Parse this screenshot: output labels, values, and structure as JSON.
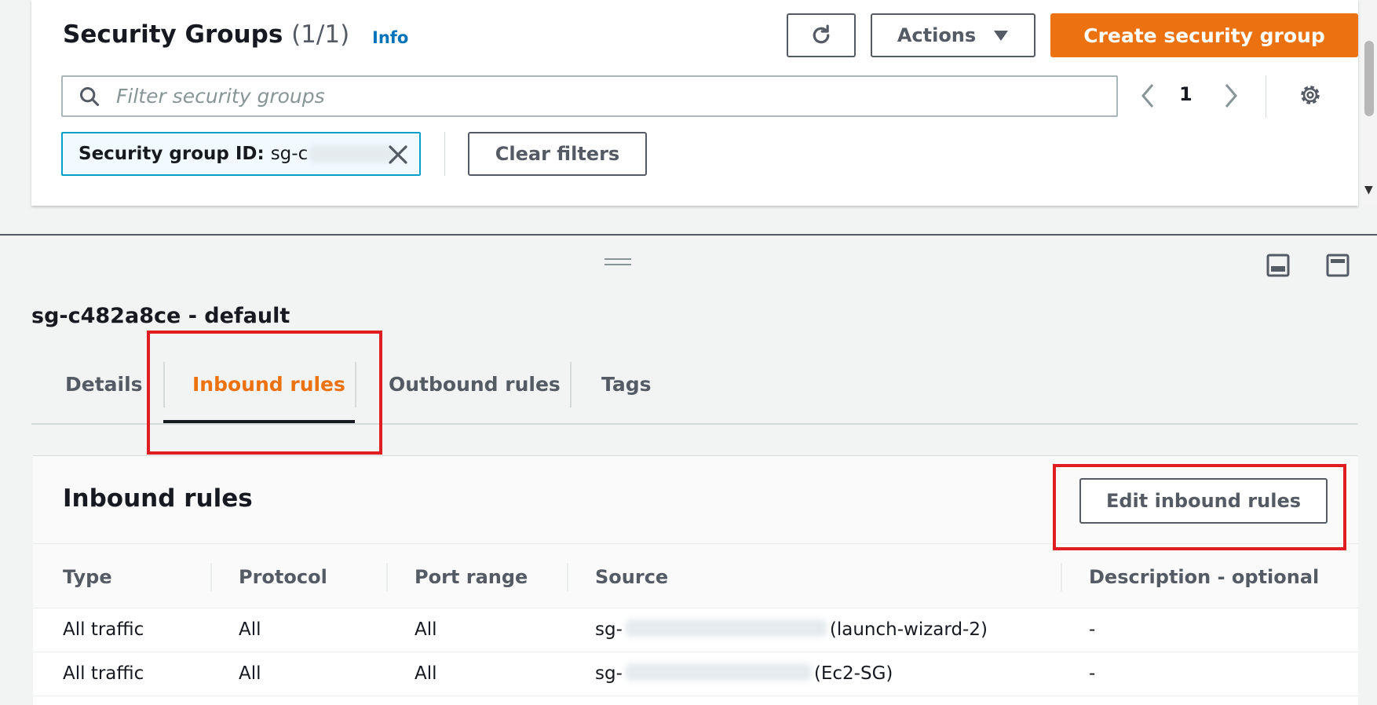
{
  "header": {
    "title": "Security Groups",
    "count": "(1/1)",
    "info_link": "Info"
  },
  "toolbar": {
    "actions_label": "Actions",
    "create_label": "Create security group"
  },
  "search": {
    "placeholder": "Filter security groups",
    "value": ""
  },
  "pagination": {
    "page": "1"
  },
  "filter_token": {
    "label": "Security group ID:",
    "value": "sg-c"
  },
  "clear_filters_label": "Clear filters",
  "details": {
    "title": "sg-c482a8ce - default"
  },
  "tabs": [
    {
      "label": "Details"
    },
    {
      "label": "Inbound rules",
      "active": true
    },
    {
      "label": "Outbound rules"
    },
    {
      "label": "Tags"
    }
  ],
  "inbound": {
    "title": "Inbound rules",
    "edit_label": "Edit inbound rules",
    "columns": [
      "Type",
      "Protocol",
      "Port range",
      "Source",
      "Description - optional"
    ],
    "rows": [
      {
        "type": "All traffic",
        "protocol": "All",
        "port": "All",
        "source_prefix": "sg-",
        "source_suffix": "(launch-wizard-2)",
        "description": "-"
      },
      {
        "type": "All traffic",
        "protocol": "All",
        "port": "All",
        "source_prefix": "sg-",
        "source_suffix": "(Ec2-SG)",
        "description": "-"
      }
    ]
  },
  "colors": {
    "accent_orange": "#ec7211",
    "link_blue": "#0073bb",
    "highlight_red": "#e01e22",
    "token_border": "#00a1c9"
  }
}
